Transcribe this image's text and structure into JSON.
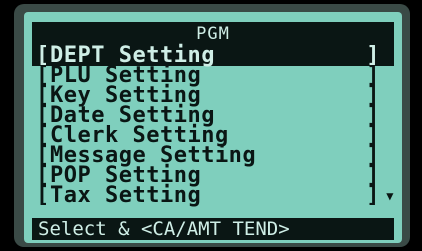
{
  "screen": {
    "title": "PGM",
    "status": "Select & <CA/AMT TEND>"
  },
  "menu": {
    "open_bracket": "[",
    "close_bracket": "]",
    "items": [
      {
        "label": "DEPT Setting"
      },
      {
        "label": "PLU Setting"
      },
      {
        "label": "Key Setting"
      },
      {
        "label": "Date Setting"
      },
      {
        "label": "Clerk Setting"
      },
      {
        "label": "Message Setting"
      },
      {
        "label": "POP Setting"
      },
      {
        "label": "Tax Setting"
      }
    ],
    "selected_index": 0,
    "scroll_indicator_icon": "triangle-down-icon"
  },
  "colors": {
    "lcd_background": "#7fcfbd",
    "lcd_foreground": "#0a1614",
    "inverse_text": "#cfeee6"
  }
}
